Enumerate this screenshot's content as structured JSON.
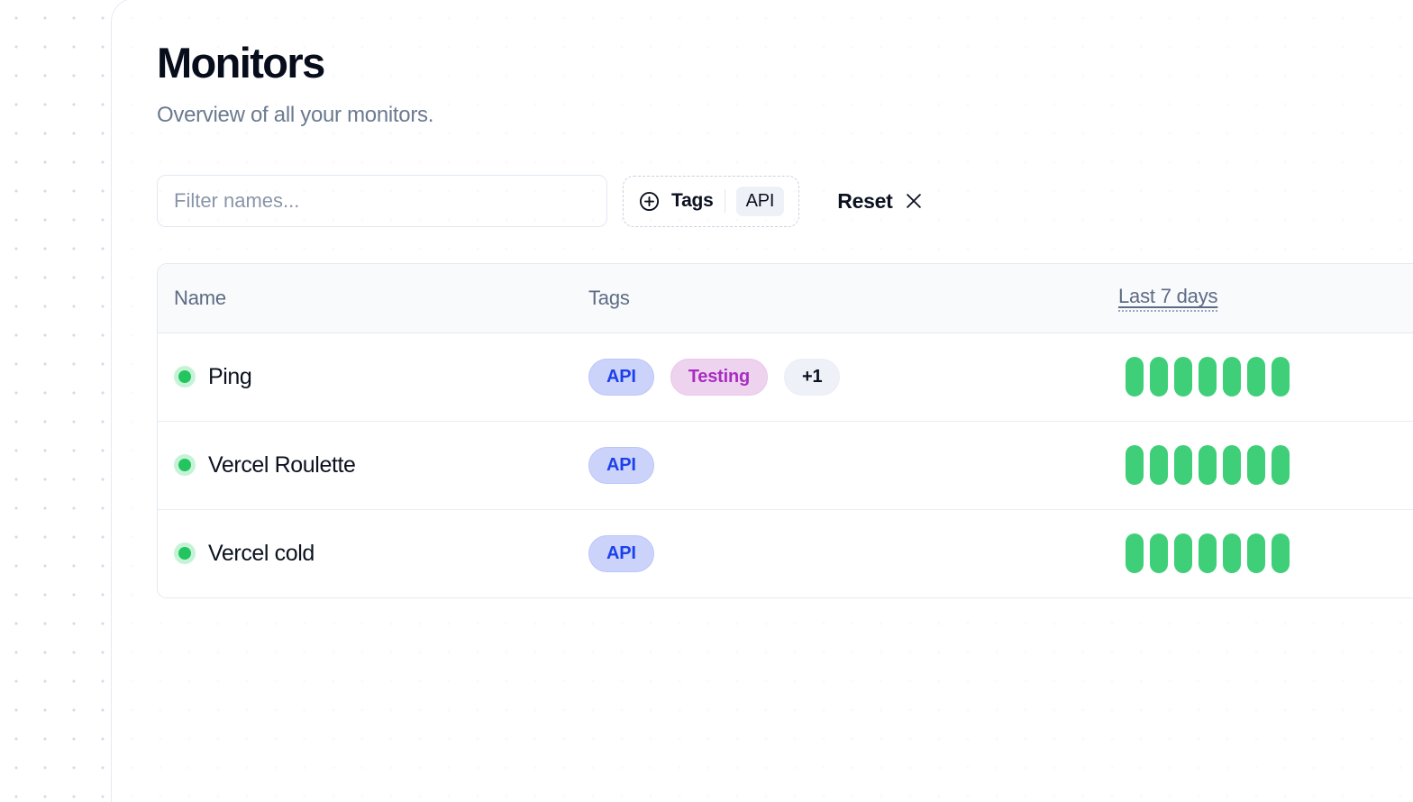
{
  "page": {
    "title": "Monitors",
    "subtitle": "Overview of all your monitors."
  },
  "filters": {
    "search": {
      "placeholder": "Filter names...",
      "value": ""
    },
    "tags_filter": {
      "icon": "plus-circle-icon",
      "label": "Tags",
      "selected": [
        "API"
      ]
    },
    "reset": {
      "label": "Reset",
      "icon": "close-icon"
    }
  },
  "table": {
    "columns": [
      {
        "key": "name",
        "label": "Name",
        "underlined": false
      },
      {
        "key": "tags",
        "label": "Tags",
        "underlined": false
      },
      {
        "key": "chart",
        "label": "Last 7 days",
        "underlined": true
      }
    ],
    "rows": [
      {
        "status": "up",
        "name": "Ping",
        "tags": [
          {
            "label": "API",
            "style": "api"
          },
          {
            "label": "Testing",
            "style": "testing"
          },
          {
            "label": "+1",
            "style": "more"
          }
        ],
        "bars": [
          "up",
          "up",
          "up",
          "up",
          "up",
          "up",
          "up"
        ]
      },
      {
        "status": "up",
        "name": "Vercel Roulette",
        "tags": [
          {
            "label": "API",
            "style": "api"
          }
        ],
        "bars": [
          "up",
          "up",
          "up",
          "up",
          "up",
          "up",
          "up"
        ]
      },
      {
        "status": "up",
        "name": "Vercel cold",
        "tags": [
          {
            "label": "API",
            "style": "api"
          }
        ],
        "bars": [
          "up",
          "up",
          "up",
          "up",
          "up",
          "up",
          "up"
        ]
      }
    ]
  },
  "colors": {
    "status_up": "#22c55e",
    "bar_up": "#3ecf78",
    "badge_api_bg": "#ccd3fb",
    "badge_api_text": "#1c41ea",
    "badge_testing_bg": "#eed3ee",
    "badge_testing_text": "#a72ec0",
    "title": "#080d1c",
    "subtitle": "#6b7a90",
    "border": "#e4e9f1"
  }
}
